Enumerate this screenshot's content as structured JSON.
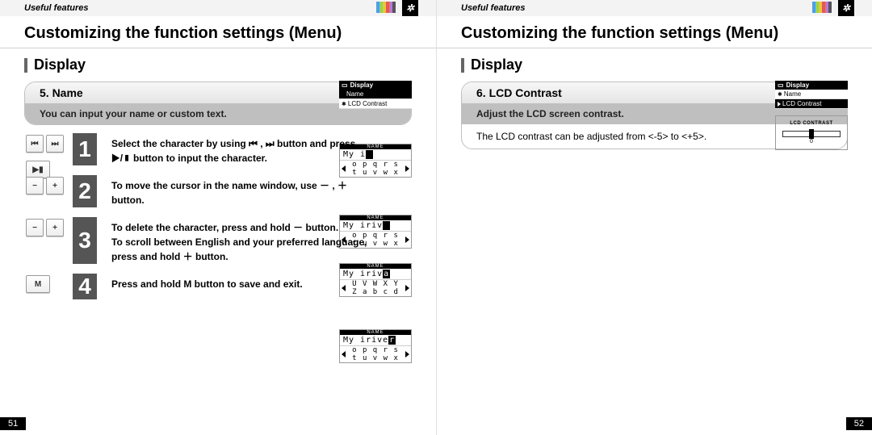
{
  "breadcrumb": "Useful features",
  "title": "Customizing the function settings (Menu)",
  "section": "Display",
  "left": {
    "feature_no": "5. Name",
    "feature_sub": "You can input your name or custom text.",
    "steps": [
      {
        "num": "1",
        "text": "Select the character by using ⏮ , ⏭ button and press ▶/▮ button to input the character."
      },
      {
        "num": "2",
        "text": "To move the cursor in the name window, use － , ＋ button."
      },
      {
        "num": "3",
        "text": "To delete the character, press and hold － button.\nTo scroll between English and your preferred language, press and hold ＋ button."
      },
      {
        "num": "4",
        "text": "Press and hold M button to save and exit."
      }
    ],
    "mini": {
      "head": "Display",
      "items": [
        "Name",
        "LCD Contrast"
      ],
      "selected": 0
    },
    "panels": [
      {
        "title": "NAME",
        "name": "My i",
        "cursor_at": 4,
        "chars": "o p q r s t u v w x",
        "hl": 3
      },
      {
        "title": "NAME",
        "name": "My iriv",
        "cursor_at": 7,
        "chars": "o p q r s t u v w x",
        "hl": 6
      },
      {
        "title": "NAME",
        "name": "My iriva",
        "cursor_at": 7,
        "chars": "U V W X Y Z a b c d",
        "hl": 6
      },
      {
        "title": "NAME",
        "name": "My iriver",
        "cursor_at": 8,
        "chars": "o p q r s t u v w x",
        "hl": 3
      }
    ],
    "pagenum": "51"
  },
  "right": {
    "feature_no": "6. LCD Contrast",
    "feature_sub": "Adjust the LCD screen contrast.",
    "body": "The LCD contrast can be adjusted from <-5> to <+5>.",
    "mini": {
      "head": "Display",
      "items": [
        "Name",
        "LCD Contrast"
      ],
      "selected": 1
    },
    "lcd_label": "LCD CONTRAST",
    "lcd_value": "0",
    "pagenum": "52"
  },
  "stripe_colors": [
    "#4aa3e0",
    "#9fd04b",
    "#f3c13a",
    "#e05a5a",
    "#b57ad6",
    "#555"
  ]
}
